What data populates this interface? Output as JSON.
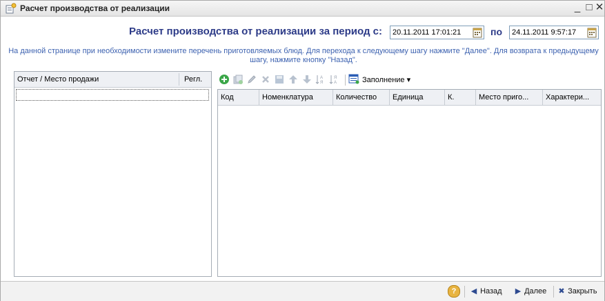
{
  "window": {
    "title": "Расчет производства от реализации",
    "minimize": "_",
    "maximize": "□",
    "close": "✕"
  },
  "header": {
    "title": "Расчет производства от реализации за период с:",
    "date_from": "20.11.2011 17:01:21",
    "separator": "по",
    "date_to": "24.11.2011  9:57:17"
  },
  "info_text": "На данной странице при необходимости измените перечень приготовляемых блюд. Для перехода к следующему шагу нажмите \"Далее\". Для возврата к предыдущему шагу, нажмите кнопку \"Назад\".",
  "left_panel": {
    "columns": [
      "Отчет / Место продажи",
      "Регл."
    ]
  },
  "toolbar": {
    "icons": [
      "add-icon",
      "copy-icon",
      "edit-icon",
      "delete-icon",
      "save-icon",
      "move-up-icon",
      "move-down-icon",
      "sort-asc-icon",
      "sort-desc-icon"
    ],
    "fill_label": "Заполнение"
  },
  "grid": {
    "columns": [
      "Код",
      "Номенклатура",
      "Количество",
      "Единица",
      "К.",
      "Место приго...",
      "Характери..."
    ]
  },
  "footer": {
    "help": "?",
    "back_label": "Назад",
    "next_label": "Далее",
    "close_label": "Закрыть"
  },
  "colors": {
    "accent_text": "#2d3b88",
    "info_text": "#3d62b0"
  }
}
